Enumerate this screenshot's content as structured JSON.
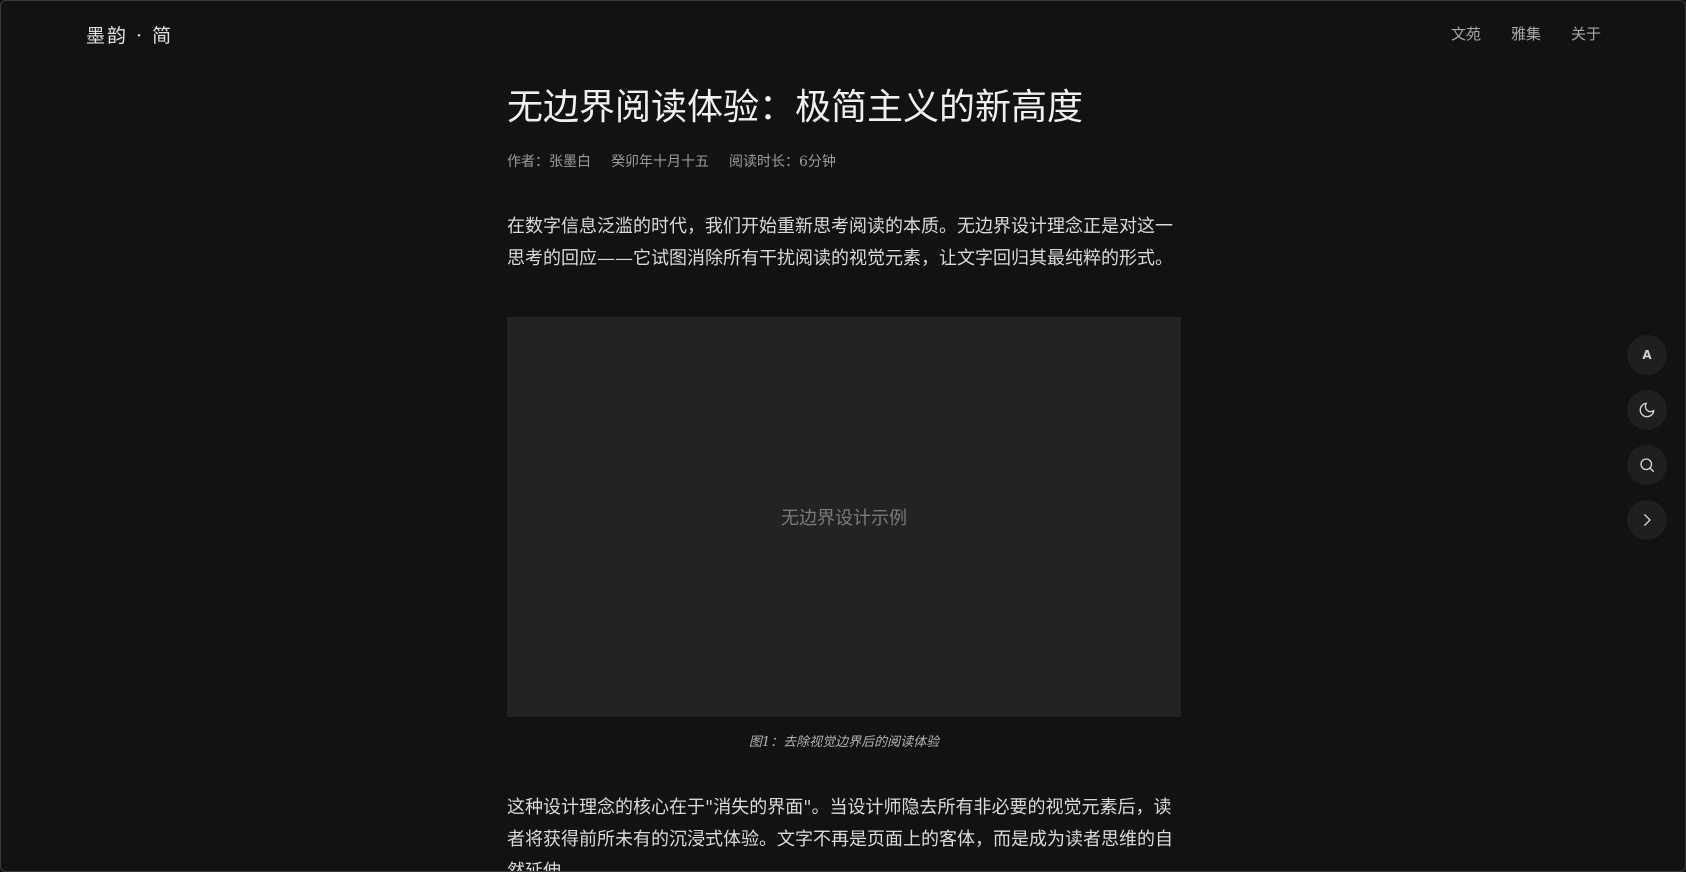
{
  "header": {
    "brand": "墨韵 · 简",
    "nav": [
      "文苑",
      "雅集",
      "关于"
    ]
  },
  "article": {
    "title": "无边界阅读体验：极简主义的新高度",
    "meta": {
      "author": "作者：张墨白",
      "date": "癸卯年十月十五",
      "read_time": "阅读时长：6分钟"
    },
    "paragraphs": [
      "在数字信息泛滥的时代，我们开始重新思考阅读的本质。无边界设计理念正是对这一思考的回应——它试图消除所有干扰阅读的视觉元素，让文字回归其最纯粹的形式。",
      "这种设计理念的核心在于\"消失的界面\"。当设计师隐去所有非必要的视觉元素后，读者将获得前所未有的沉浸式体验。文字不再是页面上的客体，而是成为读者思维的自然延伸。"
    ],
    "figure": {
      "placeholder": "无边界设计示例",
      "caption": "图1：去除视觉边界后的阅读体验"
    }
  },
  "side_tools": {
    "font_glyph": "A",
    "icons": [
      "font-size-icon",
      "moon-icon",
      "search-icon",
      "chevron-right-icon"
    ]
  }
}
